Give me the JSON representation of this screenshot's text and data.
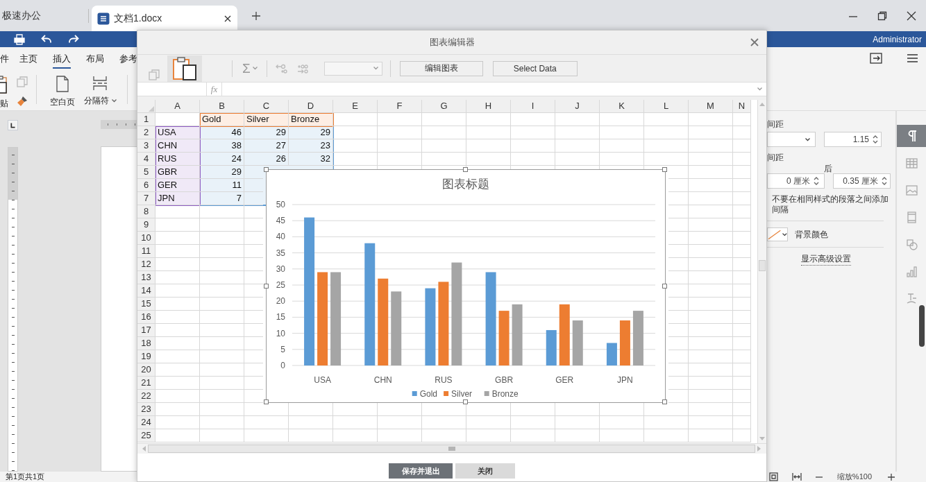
{
  "title_bar": {
    "app_name": "极速办公",
    "tabs": [
      {
        "label": "文档1.docx",
        "selected": true
      }
    ]
  },
  "quick_bar": {
    "user": "Administrator"
  },
  "ribbon": {
    "tabs": [
      {
        "label": "件",
        "selected": false
      },
      {
        "label": "主页",
        "selected": false
      },
      {
        "label": "插入",
        "selected": true
      },
      {
        "label": "布局",
        "selected": false
      },
      {
        "label": "参考",
        "selected": false
      }
    ],
    "buttons": [
      {
        "kind": "paste",
        "label": "贴",
        "dropdown": false
      },
      {
        "kind": "clipboard-tools"
      },
      {
        "kind": "blank-page",
        "label": "空白页",
        "dropdown": false
      },
      {
        "kind": "break",
        "label": "分隔符",
        "dropdown": true
      }
    ]
  },
  "format_panel": {
    "line_spacing_label": "间距",
    "line_spacing_value": "1.15",
    "paragraph_spacing_label": "间距",
    "after_label": "后",
    "before_value": "0 厘米",
    "after_value": "0.35 厘米",
    "no_space_label": "不要在相同样式的段落之间添加间隔",
    "background_color_label": "背景颜色",
    "advanced_link": "显示高级设置"
  },
  "side_tabs": [
    {
      "kind": "paragraph",
      "selected": true
    },
    {
      "kind": "table",
      "selected": false
    },
    {
      "kind": "image",
      "selected": false
    },
    {
      "kind": "header",
      "selected": false
    },
    {
      "kind": "shape",
      "selected": false
    },
    {
      "kind": "chart",
      "selected": false
    },
    {
      "kind": "text-art",
      "selected": false
    }
  ],
  "status_bar": {
    "page_info": "第1页共1页",
    "zoom": "缩放%100"
  },
  "chart_editor": {
    "title": "图表编辑器",
    "toolbar": {
      "sum_symbol": "Σ",
      "buttons": [
        {
          "label": "编辑图表"
        },
        {
          "label": "Select Data"
        }
      ]
    },
    "formula_bar": {
      "fx": "fx"
    },
    "sheet": {
      "columns": [
        "A",
        "B",
        "C",
        "D",
        "E",
        "F",
        "G",
        "H",
        "I",
        "J",
        "K",
        "L",
        "M",
        "N"
      ],
      "rows": [
        {
          "number": "1",
          "cells": {
            "B": "Gold",
            "C": "Silver",
            "D": "Bronze"
          }
        },
        {
          "number": "2",
          "cells": {
            "A": "USA",
            "B": "46",
            "C": "29",
            "D": "29"
          }
        },
        {
          "number": "3",
          "cells": {
            "A": "CHN",
            "B": "38",
            "C": "27",
            "D": "23"
          }
        },
        {
          "number": "4",
          "cells": {
            "A": "RUS",
            "B": "24",
            "C": "26",
            "D": "32"
          }
        },
        {
          "number": "5",
          "cells": {
            "A": "GBR",
            "B": "29"
          }
        },
        {
          "number": "6",
          "cells": {
            "A": "GER",
            "B": "11"
          }
        },
        {
          "number": "7",
          "cells": {
            "A": "JPN",
            "B": "7"
          }
        },
        {
          "number": "8"
        },
        {
          "number": "9"
        },
        {
          "number": "10"
        },
        {
          "number": "11"
        },
        {
          "number": "12"
        },
        {
          "number": "13"
        },
        {
          "number": "14"
        },
        {
          "number": "15"
        },
        {
          "number": "16"
        },
        {
          "number": "17"
        },
        {
          "number": "18"
        },
        {
          "number": "19"
        },
        {
          "number": "20"
        },
        {
          "number": "21"
        },
        {
          "number": "22"
        },
        {
          "number": "23"
        },
        {
          "number": "24"
        },
        {
          "number": "25"
        }
      ],
      "ranges": [
        {
          "kind": "values",
          "color": "#5b9bd5"
        },
        {
          "kind": "categories",
          "color": "#8e5cc4"
        },
        {
          "kind": "series-names",
          "color": "#ed7d31"
        }
      ]
    },
    "chart": {
      "chart_data": {
        "type": "bar",
        "title": "图表标题",
        "categories": [
          "USA",
          "CHN",
          "RUS",
          "GBR",
          "GER",
          "JPN"
        ],
        "series": [
          {
            "name": "Gold",
            "color": "#5b9bd5",
            "values": [
              46,
              38,
              24,
              29,
              11,
              7
            ]
          },
          {
            "name": "Silver",
            "color": "#ed7d31",
            "values": [
              29,
              27,
              26,
              17,
              19,
              14
            ]
          },
          {
            "name": "Bronze",
            "color": "#a5a5a5",
            "values": [
              29,
              23,
              32,
              19,
              14,
              17
            ]
          }
        ],
        "grid": true,
        "legend": "bottom",
        "ylim": [
          0,
          50
        ],
        "yticks": [
          {
            "value": 0,
            "label": "0"
          },
          {
            "value": 5,
            "label": "5"
          },
          {
            "value": 10,
            "label": "10"
          },
          {
            "value": 15,
            "label": "15"
          },
          {
            "value": 20,
            "label": "20"
          },
          {
            "value": 25,
            "label": "25"
          },
          {
            "value": 30,
            "label": "30"
          },
          {
            "value": 35,
            "label": "35"
          },
          {
            "value": 40,
            "label": "40"
          },
          {
            "value": 45,
            "label": "45"
          },
          {
            "value": 50,
            "label": "50"
          }
        ]
      }
    },
    "footer_buttons": [
      {
        "label": "保存并退出",
        "kind": "primary"
      },
      {
        "label": "关闭",
        "kind": "secondary"
      }
    ]
  }
}
